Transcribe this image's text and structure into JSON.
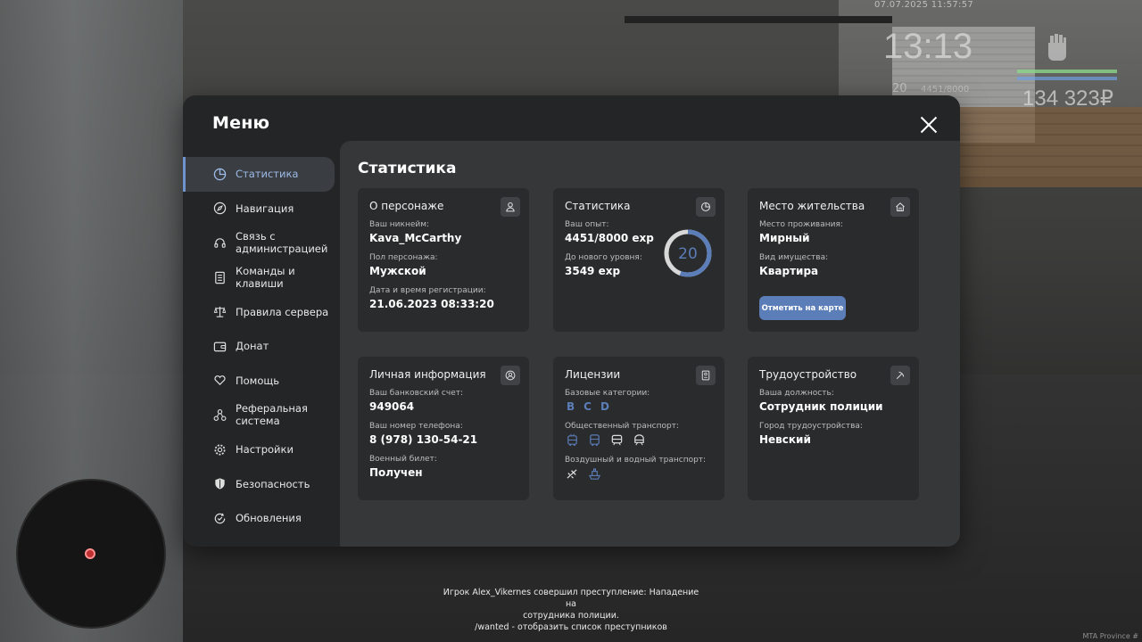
{
  "hud": {
    "datetime": "07.07.2025 11:57:57",
    "clock": "13:13",
    "level": "20",
    "exp": "4451/8000",
    "money": "134 323₽",
    "watermark": "MTA Province #"
  },
  "chat": {
    "line1": "Игрок Alex_Vikernes совершил преступление: Нападение на",
    "line2": "сотрудника полиции.",
    "line3": "/wanted - отобразить список преступников"
  },
  "menu": {
    "title": "Меню",
    "sidebar": [
      {
        "label": "Статистика",
        "icon": "pie-chart-icon"
      },
      {
        "label": "Навигация",
        "icon": "compass-icon"
      },
      {
        "label": "Связь с администрацией",
        "icon": "headset-icon"
      },
      {
        "label": "Команды и клавиши",
        "icon": "list-document-icon"
      },
      {
        "label": "Правила сервера",
        "icon": "scales-icon"
      },
      {
        "label": "Донат",
        "icon": "wallet-icon"
      },
      {
        "label": "Помощь",
        "icon": "heart-hand-icon"
      },
      {
        "label": "Реферальная система",
        "icon": "referral-network-icon"
      },
      {
        "label": "Настройки",
        "icon": "gear-icon"
      },
      {
        "label": "Безопасность",
        "icon": "shield-icon"
      },
      {
        "label": "Обновления",
        "icon": "refresh-check-icon"
      }
    ],
    "content_title": "Статистика"
  },
  "cards": {
    "character": {
      "title": "О персонаже",
      "nickname_label": "Ваш никнейм:",
      "nickname": "Kava_McCarthy",
      "gender_label": "Пол персонажа:",
      "gender": "Мужской",
      "reg_label": "Дата и время регистрации:",
      "reg": "21.06.2023 08:33:20"
    },
    "stats": {
      "title": "Статистика",
      "exp_label": "Ваш опыт:",
      "exp": "4451/8000 exp",
      "next_label": "До нового уровня:",
      "next": "3549 exp",
      "level": "20",
      "progress": 0.556
    },
    "residence": {
      "title": "Место жительства",
      "place_label": "Место проживания:",
      "place": "Мирный",
      "type_label": "Вид имущества:",
      "type": "Квартира",
      "button": "Отметить на карте"
    },
    "personal": {
      "title": "Личная информация",
      "bank_label": "Ваш банковский счет:",
      "bank": "949064",
      "phone_label": "Ваш номер телефона:",
      "phone": "8 (978) 130-54-21",
      "military_label": "Военный билет:",
      "military": "Получен"
    },
    "licenses": {
      "title": "Лицензии",
      "base_label": "Базовые категории:",
      "categories": [
        "B",
        "C",
        "D"
      ],
      "public_label": "Общественный транспорт:",
      "air_label": "Воздушный и водный транспорт:"
    },
    "job": {
      "title": "Трудоустройство",
      "position_label": "Ваша должность:",
      "position": "Сотрудник полиции",
      "city_label": "Город трудоустройства:",
      "city": "Невский"
    }
  },
  "colors": {
    "accent": "#5b7db8",
    "panel": "#242526",
    "content": "#363738",
    "card": "#2a2b2c"
  }
}
